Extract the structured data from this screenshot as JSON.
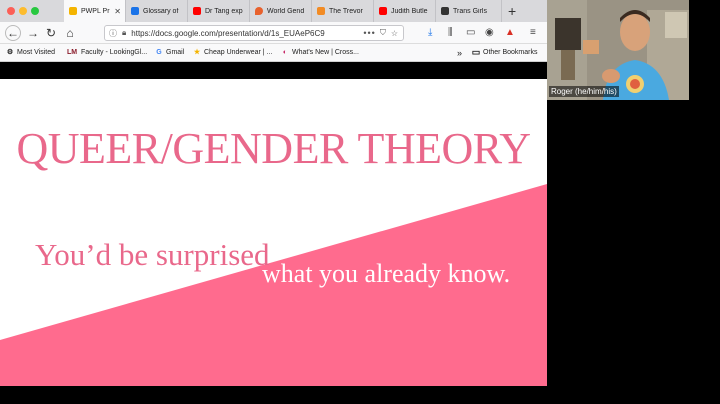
{
  "browser": {
    "tabs": [
      {
        "label": "PWPL Pr",
        "color": "#f4b400",
        "active": true
      },
      {
        "label": "Glossary of",
        "color": "#1a73e8",
        "active": false
      },
      {
        "label": "Dr Tang exp",
        "color": "#ff0000",
        "active": false
      },
      {
        "label": "World Gend",
        "color": "#e8612c",
        "active": false
      },
      {
        "label": "The Trevor",
        "color": "#f28b24",
        "active": false
      },
      {
        "label": "Judith Butle",
        "color": "#ff0000",
        "active": false
      },
      {
        "label": "Trans Girls",
        "color": "#333333",
        "active": false
      }
    ],
    "new_tab": "+",
    "url": "https://docs.google.com/presentation/d/1s_EUAeP6C9",
    "url_more": "•••",
    "bookmarks": [
      {
        "label": "Most Visited",
        "icon": "gear-icon",
        "glyph": "⚙"
      },
      {
        "label": "Faculty - LookingGl...",
        "icon": "lm-icon",
        "glyph": "LM"
      },
      {
        "label": "Gmail",
        "icon": "google-icon",
        "glyph": "G"
      },
      {
        "label": "Cheap Underwear | ...",
        "icon": "star-icon",
        "glyph": "★"
      },
      {
        "label": "What's New | Cross...",
        "icon": "site-icon",
        "glyph": "◐"
      }
    ],
    "other_bookmarks": "Other Bookmarks"
  },
  "slide": {
    "title": "QUEER/GENDER THEORY",
    "subtitle_part1": "You’d be surprised",
    "subtitle_part2": "what you already know.",
    "accent": "#ff6b8e",
    "text_color": "#e9688b"
  },
  "video": {
    "participant": "Roger (he/him/his)"
  }
}
